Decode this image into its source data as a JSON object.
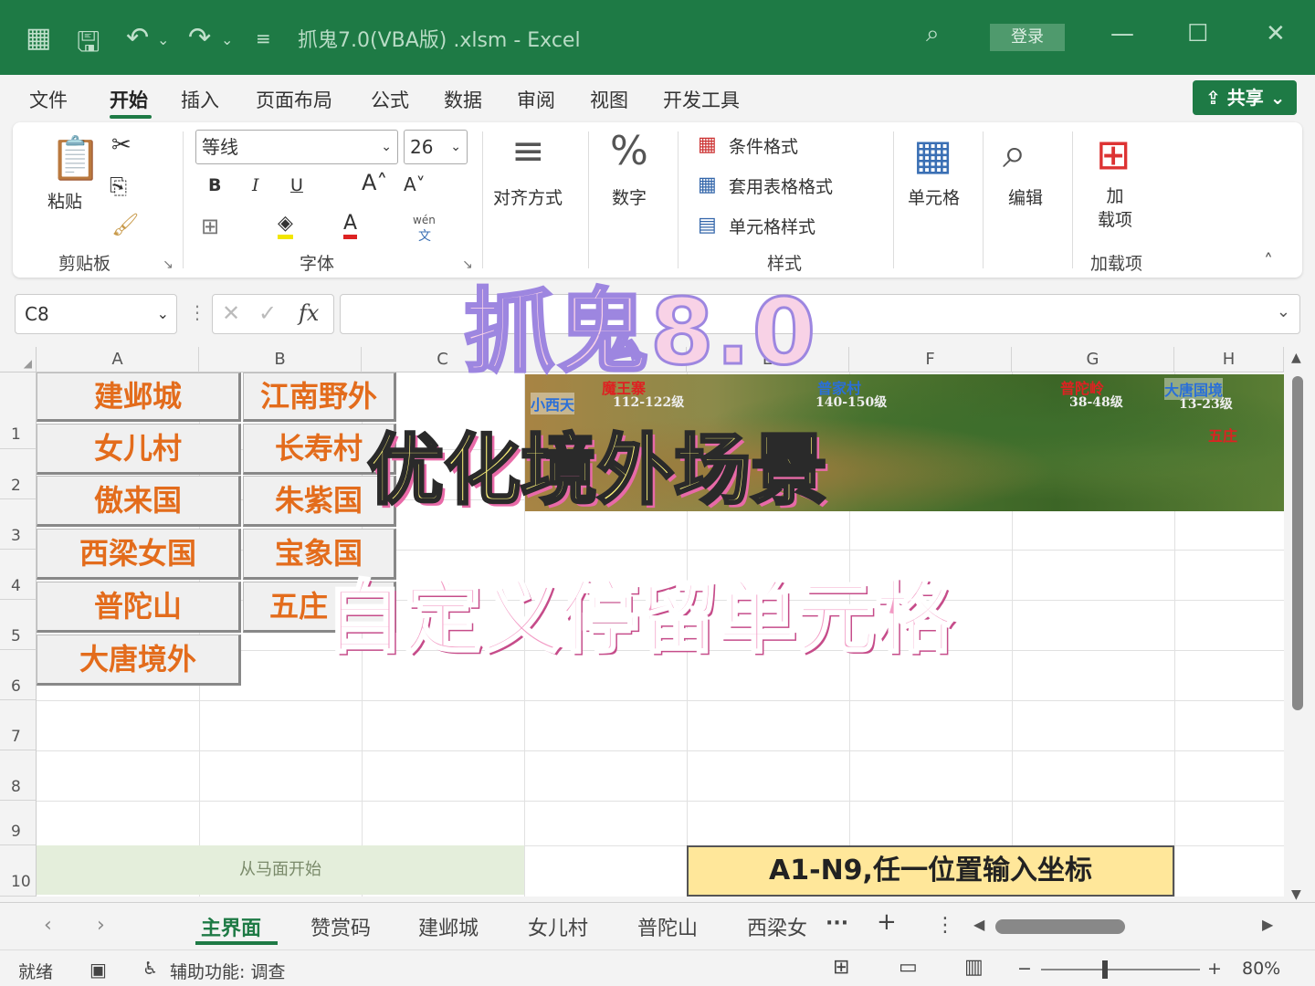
{
  "titlebar": {
    "doc_title": "抓鬼7.0(VBA版) .xlsm  -  Excel",
    "login": "登录"
  },
  "menu": {
    "tabs": [
      "文件",
      "开始",
      "插入",
      "页面布局",
      "公式",
      "数据",
      "审阅",
      "视图",
      "开发工具"
    ],
    "active": "开始",
    "share": "共享"
  },
  "ribbon": {
    "paste": "粘贴",
    "clipboard_group": "剪贴板",
    "font_name": "等线",
    "font_size": "26",
    "bold": "B",
    "italic": "I",
    "underline": "U",
    "font_group": "字体",
    "align": "对齐方式",
    "number": "数字",
    "cond_format": "条件格式",
    "table_format": "套用表格格式",
    "cell_style": "单元格样式",
    "style_group": "样式",
    "cells": "单元格",
    "edit": "编辑",
    "addin": "加\n载项",
    "addin_group": "加载项",
    "pinyin_top": "wén",
    "pinyin_bottom": "文"
  },
  "formula": {
    "namebox": "C8",
    "fx": "fx",
    "value": ""
  },
  "grid": {
    "columns": [
      "A",
      "B",
      "C",
      "D",
      "E",
      "F",
      "G",
      "H"
    ],
    "rows": [
      "1",
      "2",
      "3",
      "4",
      "5",
      "6",
      "7",
      "8",
      "9",
      "10"
    ],
    "col_a_buttons": [
      "建邺城",
      "女儿村",
      "傲来国",
      "西梁女国",
      "普陀山",
      "大唐境外"
    ],
    "col_b_buttons": [
      "江南野外",
      "长寿村",
      "朱紫国",
      "宝象国",
      "五庄"
    ],
    "map_labels": [
      "魔王寨",
      "小西天",
      "112-122级",
      "普家村",
      "140-150级",
      "普陀岭",
      "38-48级",
      "大唐国境",
      "13-23级",
      "五庄"
    ],
    "merged_note": "从马面开始",
    "coord_hint": "A1-N9,任一位置输入坐标"
  },
  "overlay": {
    "title": "抓鬼8.0",
    "subtitle1": "优化境外场景",
    "subtitle2": "自定义停留单元格"
  },
  "sheets": {
    "tabs": [
      "主界面",
      "赞赏码",
      "建邺城",
      "女儿村",
      "普陀山",
      "西梁女"
    ],
    "active": "主界面",
    "more": "···",
    "add": "+"
  },
  "status": {
    "ready": "就绪",
    "accessibility": "辅助功能: 调查",
    "zoom": "80%",
    "zoom_level": 0.8
  },
  "colors": {
    "excel_green": "#1e7a45",
    "city_text": "#e36c1c",
    "coord_fill": "#ffe79a"
  }
}
